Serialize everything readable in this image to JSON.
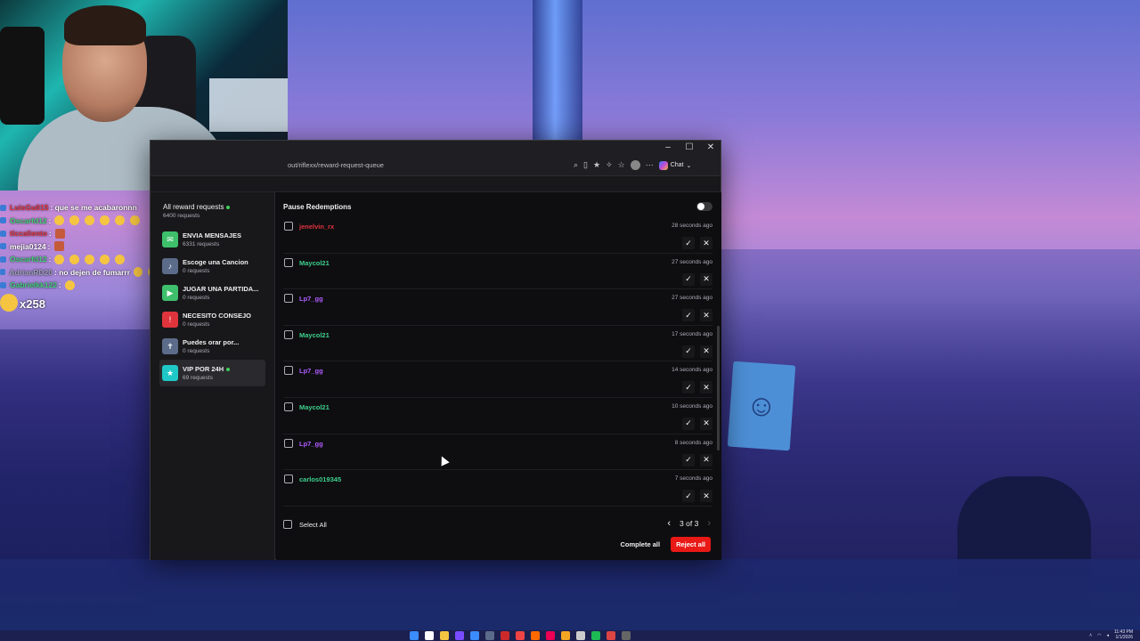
{
  "webcam": {
    "description_icon": "webcam-feed"
  },
  "chat_overlay": {
    "lines": [
      {
        "user": "LuisGu015",
        "user_color": "#e0343d",
        "text": ": que se me acabaronnn",
        "emotes": 0
      },
      {
        "user": "Oscarfd12",
        "user_color": "#41d07a",
        "text": ":",
        "emotes": 6
      },
      {
        "user": "tlccaliento",
        "user_color": "#e0343d",
        "text": ":",
        "emotes": 1
      },
      {
        "user": "mejia0124",
        "user_color": "#ffffff",
        "text": ":",
        "emotes": 1
      },
      {
        "user": "Oscarfd12",
        "user_color": "#41d07a",
        "text": ":",
        "emotes": 5
      },
      {
        "user": "AdrianRD20",
        "user_color": "#9aa0b5",
        "text": ": no dejen de fumarrr",
        "emotes": 4
      },
      {
        "user": "Gabrielkk122",
        "user_color": "#41d07a",
        "text": ":",
        "emotes": 1
      }
    ],
    "big_emote_count": "x258"
  },
  "browser": {
    "url": "out/riflexx/reward-request-queue",
    "chat_label": "Chat",
    "window_controls": {
      "minimize": "–",
      "maximize": "☐",
      "close": "✕"
    }
  },
  "sidebar": {
    "all": {
      "title": "All reward requests",
      "count": "6400 requests"
    },
    "items": [
      {
        "name": "ENVIA MENSAJES",
        "count": "6331 requests",
        "icon_color": "#3ebf6b",
        "live": false
      },
      {
        "name": "Escoge una Cancion",
        "count": "0 requests",
        "icon_color": "#5b6b8a",
        "live": false
      },
      {
        "name": "JUGAR UNA PARTIDA...",
        "count": "0 requests",
        "icon_color": "#3ebf6b",
        "live": false
      },
      {
        "name": "NECESITO CONSEJO",
        "count": "0 requests",
        "icon_color": "#e0343d",
        "live": false
      },
      {
        "name": "Puedes orar por...",
        "count": "0 requests",
        "icon_color": "#5b6b8a",
        "live": false
      },
      {
        "name": "VIP POR 24H",
        "count": "69 requests",
        "icon_color": "#1fc7c7",
        "live": true
      }
    ]
  },
  "main": {
    "pause_label": "Pause Redemptions",
    "queue": [
      {
        "user": "jenelvin_rx",
        "color": "#e0343d",
        "time": "28 seconds ago"
      },
      {
        "user": "Maycol21",
        "color": "#3ecf8e",
        "time": "27 seconds ago"
      },
      {
        "user": "Lp7_gg",
        "color": "#b05cff",
        "time": "27 seconds ago"
      },
      {
        "user": "Maycol21",
        "color": "#3ecf8e",
        "time": "17 seconds ago"
      },
      {
        "user": "Lp7_gg",
        "color": "#b05cff",
        "time": "14 seconds ago"
      },
      {
        "user": "Maycol21",
        "color": "#3ecf8e",
        "time": "10 seconds ago"
      },
      {
        "user": "Lp7_gg",
        "color": "#b05cff",
        "time": "8 seconds ago"
      },
      {
        "user": "carlos019345",
        "color": "#3ecf8e",
        "time": "7 seconds ago"
      }
    ],
    "select_all": "Select All",
    "pager": "3 of 3",
    "complete_all": "Complete all",
    "reject_all": "Reject all"
  },
  "taskbar": {
    "clock_time": "11:43 PM",
    "clock_date": "1/1/2026"
  }
}
